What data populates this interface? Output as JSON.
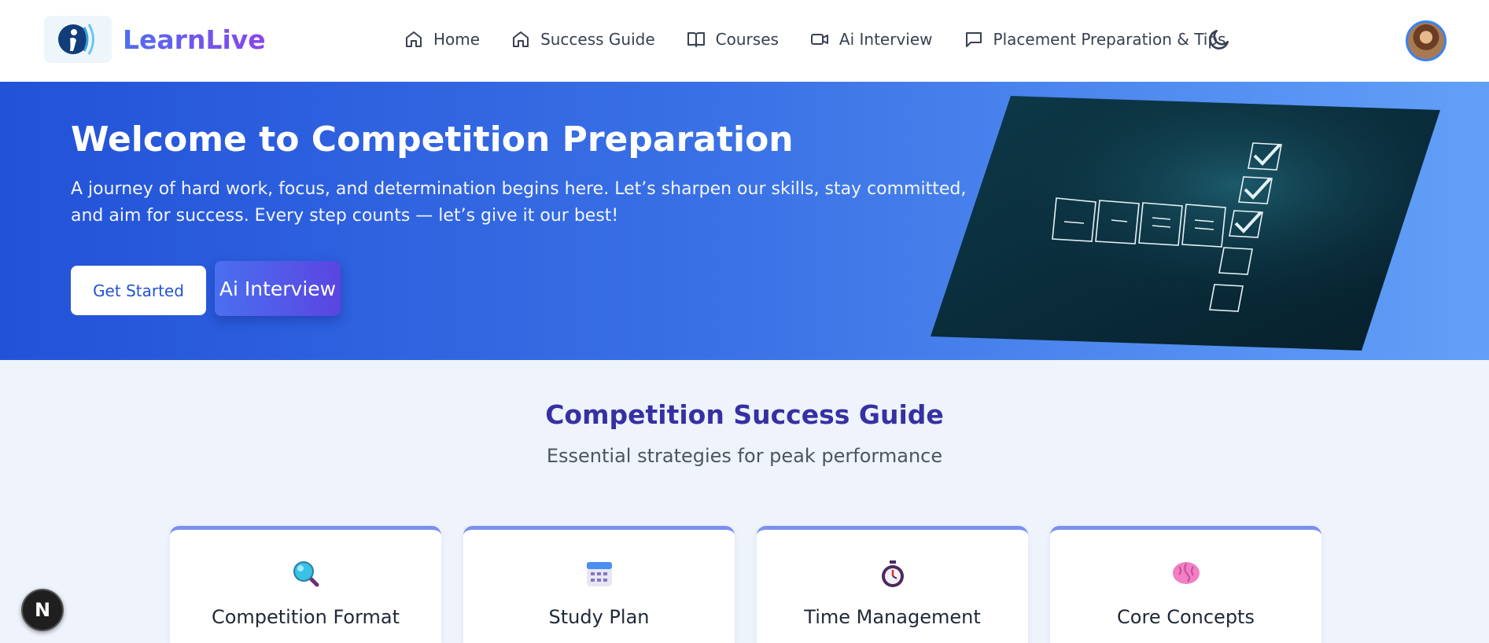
{
  "brand": {
    "name": "LearnLive",
    "logo_icon": "learnlive-logo-icon"
  },
  "nav": {
    "items": [
      {
        "label": "Home",
        "icon": "home-icon"
      },
      {
        "label": "Success Guide",
        "icon": "home-icon"
      },
      {
        "label": "Courses",
        "icon": "book-open-icon"
      },
      {
        "label": "Ai Interview",
        "icon": "video-icon"
      },
      {
        "label": "Placement Preparation & Tips",
        "icon": "message-square-icon"
      }
    ],
    "theme_toggle_icon": "moon-icon",
    "avatar_icon": "user-avatar"
  },
  "hero": {
    "title": "Welcome to Competition Preparation",
    "text": "A journey of hard work, focus, and determination begins here. Let’s sharpen our skills, stay committed, and aim for success. Every step counts — let’s give it our best!",
    "primary_button": "Get Started",
    "secondary_button": "Ai Interview",
    "image_icon": "checklist-illustration"
  },
  "guide": {
    "title": "Competition Success Guide",
    "subtitle": "Essential strategies for peak performance",
    "cards": [
      {
        "title": "Competition Format",
        "icon": "magnifying-glass-icon"
      },
      {
        "title": "Study Plan",
        "icon": "calendar-icon"
      },
      {
        "title": "Time Management",
        "icon": "stopwatch-icon"
      },
      {
        "title": "Core Concepts",
        "icon": "brain-icon"
      }
    ]
  },
  "floating_badge": {
    "label": "N",
    "icon": "nextjs-badge"
  },
  "colors": {
    "brand_start": "#4f6df0",
    "brand_end": "#8b45e8",
    "hero_start": "#2252d8",
    "hero_end": "#62a0f8",
    "guide_title": "#3730a3",
    "card_accent": "#7c8ff0"
  }
}
